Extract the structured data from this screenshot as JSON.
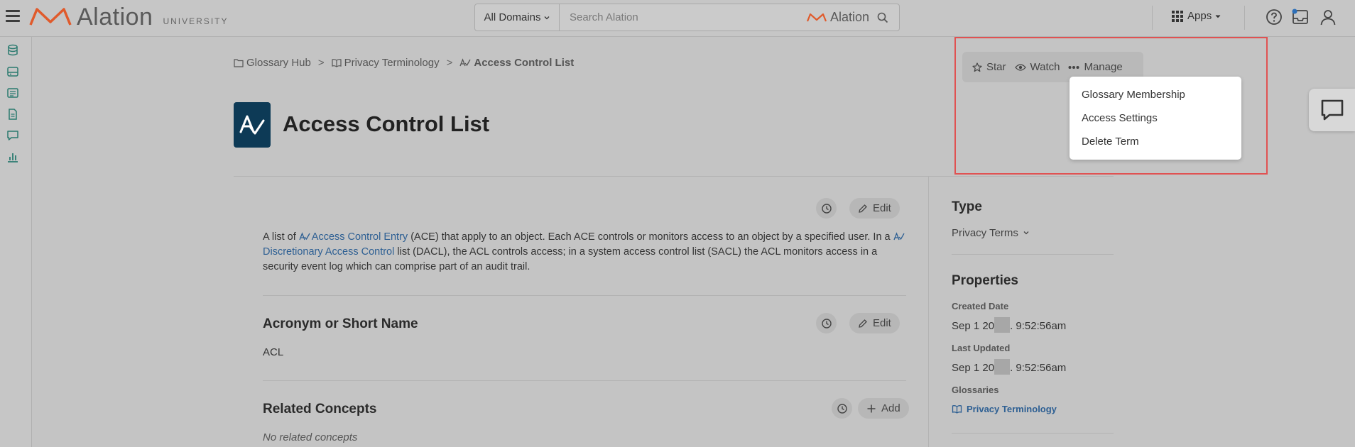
{
  "brand": {
    "name": "Alation",
    "sub": "UNIVERSITY"
  },
  "search": {
    "domains_label": "All Domains",
    "placeholder": "Search Alation",
    "brand_label": "Alation"
  },
  "header": {
    "apps_label": "Apps"
  },
  "breadcrumb": {
    "items": [
      "Glossary Hub",
      "Privacy Terminology",
      "Access Control List"
    ],
    "separator": ">"
  },
  "page": {
    "title": "Access Control List"
  },
  "description": {
    "part1": "A list of ",
    "link1": "Access Control Entry",
    "part2": " (ACE) that apply to an object. Each ACE controls or monitors access to an object by a specified user. In a ",
    "link2": "Discretionary Access Control",
    "part3": " list (DACL), the ACL controls access; in a system access control list (SACL) the ACL monitors access in a security event log which can comprise part of an audit trail."
  },
  "buttons": {
    "edit": "Edit",
    "add": "Add"
  },
  "acronym": {
    "title": "Acronym or Short Name",
    "value": "ACL"
  },
  "related": {
    "title": "Related Concepts",
    "empty": "No related concepts"
  },
  "type": {
    "title": "Type",
    "value": "Privacy Terms"
  },
  "properties": {
    "title": "Properties",
    "created_label": "Created Date",
    "created_pre": "Sep 1 20",
    "created_post": ". 9:52:56am",
    "updated_label": "Last Updated",
    "updated_pre": "Sep 1 20",
    "updated_post": ". 9:52:56am",
    "glossaries_label": "Glossaries",
    "glossary_link": "Privacy Terminology"
  },
  "actions": {
    "star": "Star",
    "watch": "Watch",
    "manage": "Manage"
  },
  "manage_menu": {
    "items": [
      "Glossary Membership",
      "Access Settings",
      "Delete Term"
    ]
  },
  "colors": {
    "accent": "#e05a2b",
    "link": "#2d5f93",
    "title_icon_bg": "#0d3a56",
    "highlight": "#e05252"
  }
}
